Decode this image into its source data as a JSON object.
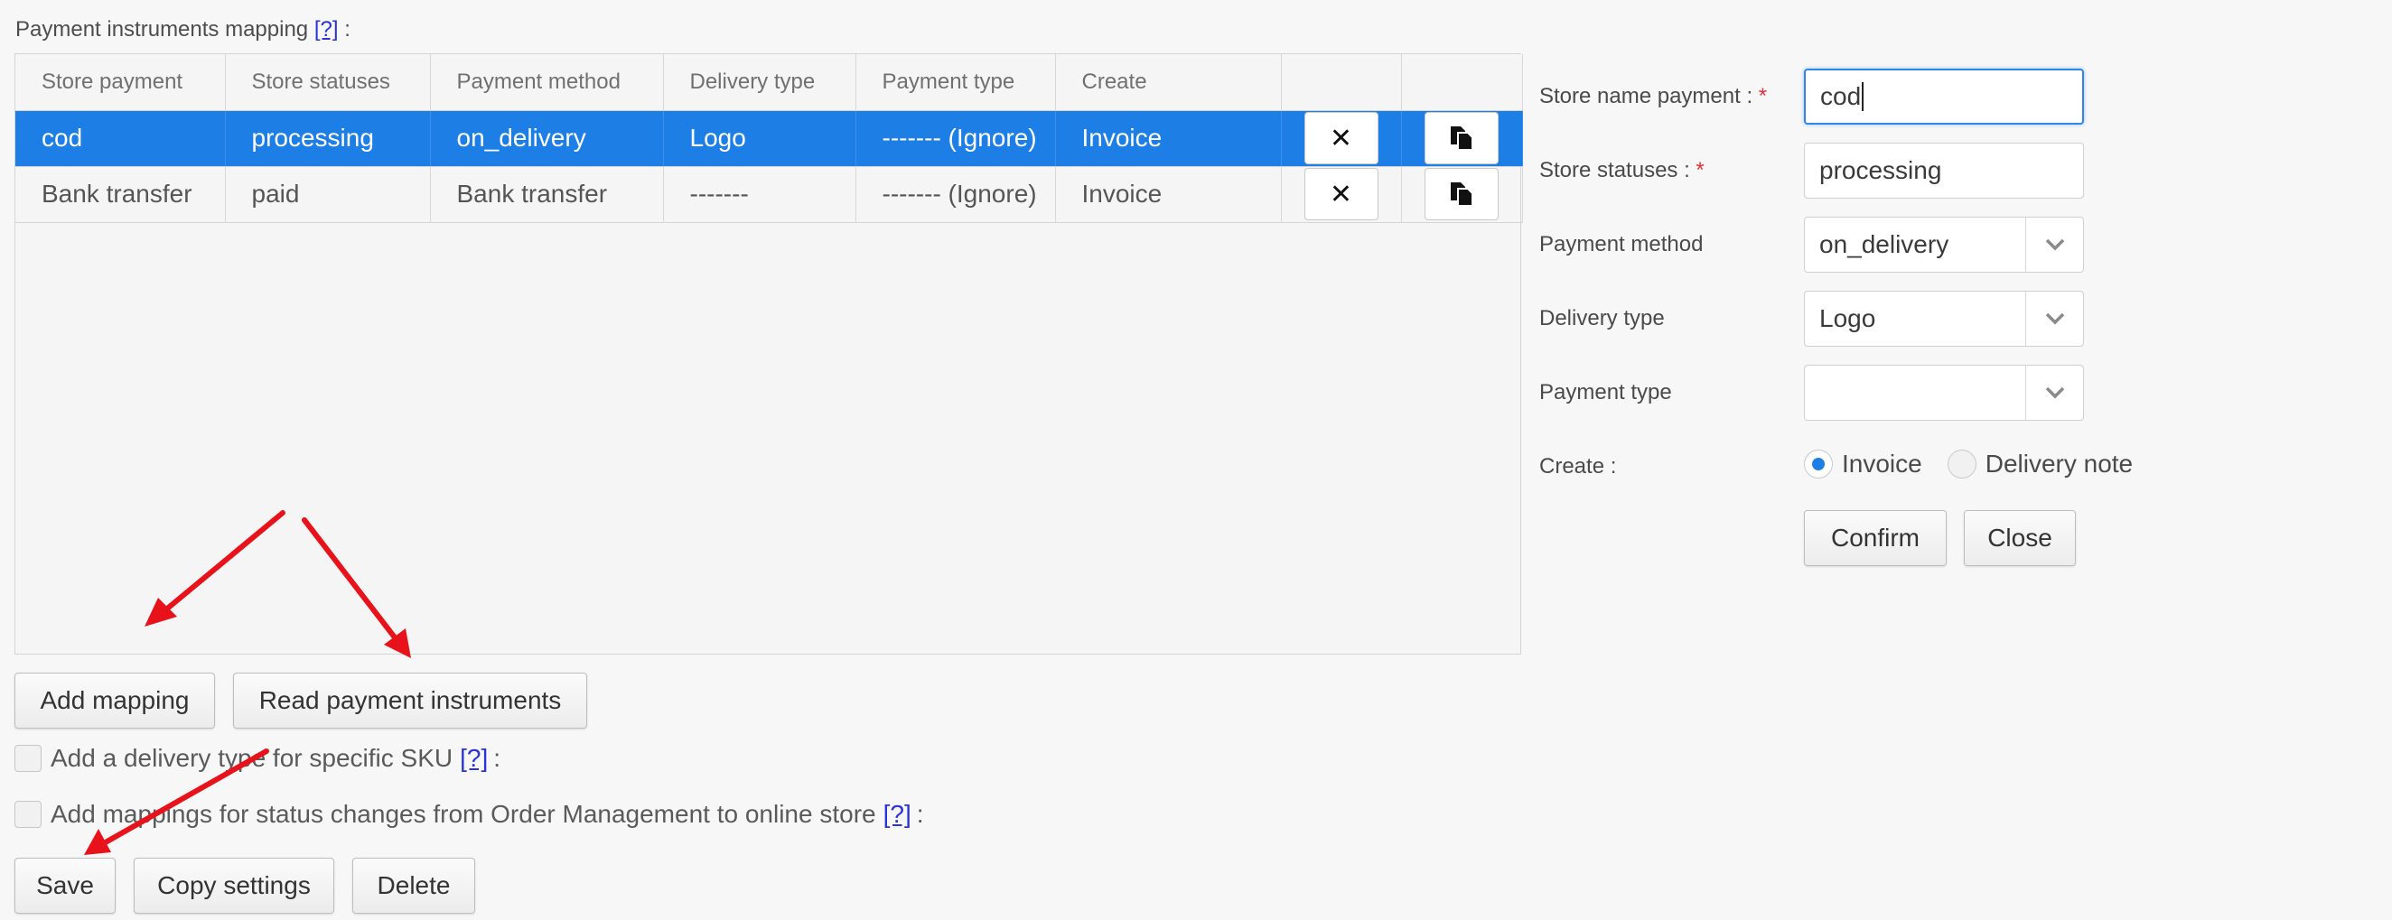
{
  "mapping": {
    "title": "Payment instruments mapping",
    "help": "[?]",
    "colon": ":",
    "columns": [
      "Store payment",
      "Store statuses",
      "Payment method",
      "Delivery type",
      "Payment type",
      "Create",
      "",
      ""
    ],
    "rows": [
      {
        "store_payment": "cod",
        "store_statuses": "processing",
        "payment_method": "on_delivery",
        "delivery_type": "Logo",
        "payment_type": "------- (Ignore)",
        "create": "Invoice",
        "selected": true
      },
      {
        "store_payment": "Bank transfer",
        "store_statuses": "paid",
        "payment_method": "Bank transfer",
        "delivery_type": "-------",
        "payment_type": "------- (Ignore)",
        "create": "Invoice",
        "selected": false
      }
    ],
    "delete_glyph": "✕",
    "copy_icon": "copy-icon"
  },
  "buttons": {
    "add_mapping": "Add mapping",
    "read_payment_instruments": "Read payment instruments",
    "save": "Save",
    "copy_settings": "Copy settings",
    "delete": "Delete"
  },
  "options": {
    "sku_label": "Add a delivery type for specific SKU",
    "status_changes_label": "Add mappings for status changes from Order Management to online store",
    "help": "[?]",
    "colon": ":"
  },
  "form": {
    "store_name_payment_label": "Store name payment :",
    "store_name_payment_value": "cod",
    "store_statuses_label": "Store statuses :",
    "store_statuses_value": "processing",
    "payment_method_label": "Payment method",
    "payment_method_value": "on_delivery",
    "delivery_type_label": "Delivery type",
    "delivery_type_value": "Logo",
    "payment_type_label": "Payment type",
    "payment_type_value": "",
    "create_label": "Create :",
    "create_options": [
      "Invoice",
      "Delivery note"
    ],
    "create_selected": "Invoice",
    "required_mark": "*",
    "confirm": "Confirm",
    "close": "Close"
  },
  "colors": {
    "accent": "#1d7fe6",
    "annotation_arrow": "#e8121b",
    "required": "#e0303a"
  }
}
